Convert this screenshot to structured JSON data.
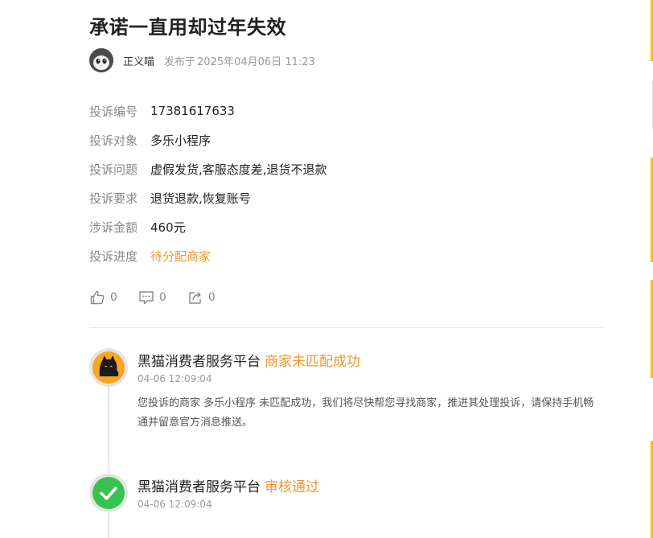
{
  "complaint": {
    "title": "承诺一直用却过年失效",
    "author": "正义喵",
    "publish_label": "发布于",
    "publish_time": "2025年04月06日 11:23"
  },
  "details": [
    {
      "label": "投诉编号",
      "value": "17381617633"
    },
    {
      "label": "投诉对象",
      "value": "多乐小程序"
    },
    {
      "label": "投诉问题",
      "value": "虚假发货,客服态度差,退货不退款"
    },
    {
      "label": "投诉要求",
      "value": "退货退款,恢复账号"
    },
    {
      "label": "涉诉金额",
      "value": "460元"
    },
    {
      "label": "投诉进度",
      "value": "待分配商家"
    }
  ],
  "actions": {
    "like_count": "0",
    "comment_count": "0",
    "share_count": "0"
  },
  "timeline": [
    {
      "source": "黑猫消费者服务平台",
      "status": "商家未匹配成功",
      "time": "04-06 12:09:04",
      "content": "您投诉的商家 多乐小程序 未匹配成功，我们将尽快帮您寻找商家，推进其处理投诉，请保持手机畅通并留意官方消息推送。",
      "icon": "black-cat-icon"
    },
    {
      "source": "黑猫消费者服务平台",
      "status": "审核通过",
      "time": "04-06 12:09:04",
      "icon": "check-circle-icon"
    }
  ],
  "colors": {
    "accent": "#f0962a",
    "cat_bg": "#f5a623",
    "check_green": "#39c24f",
    "edge_yellow": "#f5c400"
  }
}
